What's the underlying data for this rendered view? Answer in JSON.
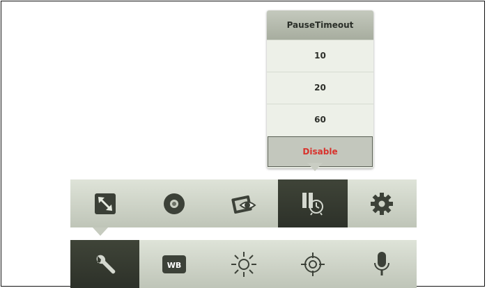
{
  "popup": {
    "title": "PauseTimeout",
    "options": [
      "10",
      "20",
      "60"
    ],
    "disable_label": "Disable"
  },
  "top_toolbar": {
    "items": [
      {
        "icon": "resize-arrows-icon"
      },
      {
        "icon": "disc-icon"
      },
      {
        "icon": "image-eye-icon"
      },
      {
        "icon": "pause-timer-icon",
        "selected": true
      },
      {
        "icon": "gear-icon"
      }
    ]
  },
  "bottom_toolbar": {
    "items": [
      {
        "icon": "wrench-icon",
        "selected": true
      },
      {
        "icon": "wb-icon",
        "label": "WB"
      },
      {
        "icon": "brightness-sun-icon"
      },
      {
        "icon": "crosshair-icon"
      },
      {
        "icon": "microphone-icon"
      }
    ]
  },
  "colors": {
    "selected_bg": "#2d3129",
    "disable_text": "#d8322c",
    "bar_bg": "#d0d5ca"
  }
}
